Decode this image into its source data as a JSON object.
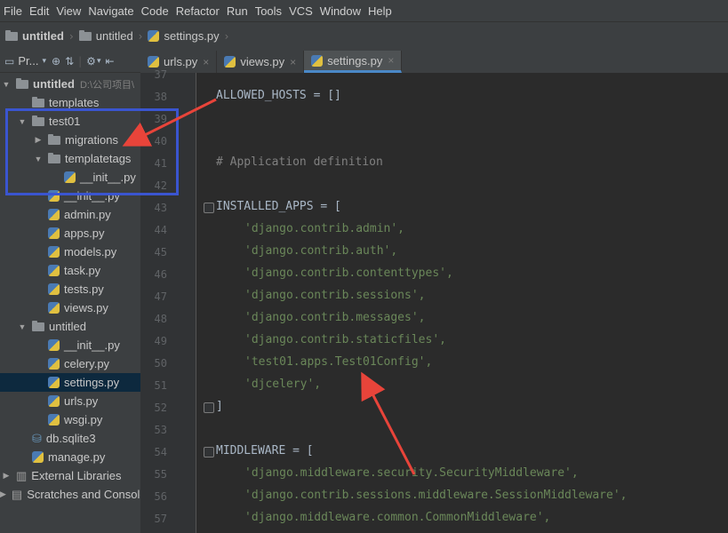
{
  "menubar": [
    "File",
    "Edit",
    "View",
    "Navigate",
    "Code",
    "Refactor",
    "Run",
    "Tools",
    "VCS",
    "Window",
    "Help"
  ],
  "breadcrumb": [
    "untitled",
    "untitled",
    "settings.py"
  ],
  "toolwindow": {
    "title": "Pr..."
  },
  "tree": [
    {
      "label": "untitled",
      "extra": "D:\\公司项目\\",
      "type": "folder",
      "level": 0,
      "expanded": true,
      "bold": true
    },
    {
      "label": "templates",
      "type": "folder",
      "level": 1
    },
    {
      "label": "test01",
      "type": "folder",
      "level": 1,
      "expanded": true
    },
    {
      "label": "migrations",
      "type": "folder",
      "level": 2,
      "expanded": false
    },
    {
      "label": "templatetags",
      "type": "folder",
      "level": 2,
      "expanded": true
    },
    {
      "label": "__init__.py",
      "type": "py",
      "level": 3
    },
    {
      "label": "__init__.py",
      "type": "py",
      "level": 2
    },
    {
      "label": "admin.py",
      "type": "py",
      "level": 2
    },
    {
      "label": "apps.py",
      "type": "py",
      "level": 2
    },
    {
      "label": "models.py",
      "type": "py",
      "level": 2
    },
    {
      "label": "task.py",
      "type": "py",
      "level": 2
    },
    {
      "label": "tests.py",
      "type": "py",
      "level": 2
    },
    {
      "label": "views.py",
      "type": "py",
      "level": 2
    },
    {
      "label": "untitled",
      "type": "folder",
      "level": 1,
      "expanded": true
    },
    {
      "label": "__init__.py",
      "type": "py",
      "level": 2
    },
    {
      "label": "celery.py",
      "type": "py",
      "level": 2
    },
    {
      "label": "settings.py",
      "type": "py",
      "level": 2,
      "selected": true
    },
    {
      "label": "urls.py",
      "type": "py",
      "level": 2
    },
    {
      "label": "wsgi.py",
      "type": "py",
      "level": 2
    },
    {
      "label": "db.sqlite3",
      "type": "db",
      "level": 1
    },
    {
      "label": "manage.py",
      "type": "py",
      "level": 1
    },
    {
      "label": "External Libraries",
      "type": "lib",
      "level": 0,
      "expanded": false
    },
    {
      "label": "Scratches and Consoles",
      "type": "scratch",
      "level": 0,
      "expanded": false
    }
  ],
  "tabs": [
    {
      "label": "urls.py",
      "active": false
    },
    {
      "label": "views.py",
      "active": false
    },
    {
      "label": "settings.py",
      "active": true
    }
  ],
  "code": [
    {
      "n": "37",
      "t": ""
    },
    {
      "n": "38",
      "t": "ALLOWED_HOSTS = []"
    },
    {
      "n": "39",
      "t": ""
    },
    {
      "n": "40",
      "t": ""
    },
    {
      "n": "41",
      "t": "# Application definition",
      "kind": "comment"
    },
    {
      "n": "42",
      "t": ""
    },
    {
      "n": "43",
      "t": "INSTALLED_APPS = [",
      "fold": true
    },
    {
      "n": "44",
      "t": "'django.contrib.admin',",
      "kind": "string"
    },
    {
      "n": "45",
      "t": "'django.contrib.auth',",
      "kind": "string"
    },
    {
      "n": "46",
      "t": "'django.contrib.contenttypes',",
      "kind": "string"
    },
    {
      "n": "47",
      "t": "'django.contrib.sessions',",
      "kind": "string"
    },
    {
      "n": "48",
      "t": "'django.contrib.messages',",
      "kind": "string"
    },
    {
      "n": "49",
      "t": "'django.contrib.staticfiles',",
      "kind": "string"
    },
    {
      "n": "50",
      "t": "'test01.apps.Test01Config',",
      "kind": "string"
    },
    {
      "n": "51",
      "t": "'djcelery',",
      "kind": "string"
    },
    {
      "n": "52",
      "t": "]",
      "fold": true
    },
    {
      "n": "53",
      "t": ""
    },
    {
      "n": "54",
      "t": "MIDDLEWARE = [",
      "fold": true
    },
    {
      "n": "55",
      "t": "'django.middleware.security.SecurityMiddleware',",
      "kind": "string"
    },
    {
      "n": "56",
      "t": "'django.contrib.sessions.middleware.SessionMiddleware',",
      "kind": "string"
    },
    {
      "n": "57",
      "t": "'django.middleware.common.CommonMiddleware',",
      "kind": "string"
    }
  ],
  "colors": {
    "annotation_box": "#3a55d0",
    "annotation_arrow": "#e8443a"
  }
}
